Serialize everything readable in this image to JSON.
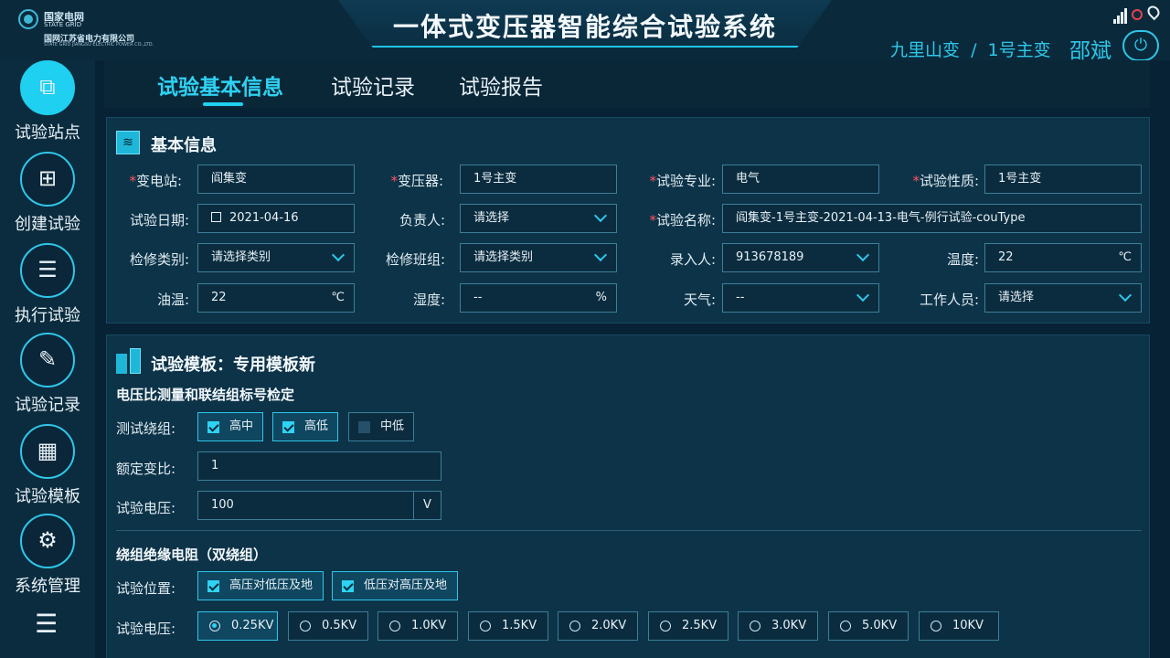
{
  "header": {
    "title": "一体式变压器智能综合试验系统",
    "logo": {
      "name": "国家电网",
      "en": "STATE GRID",
      "sub": "国网江苏省电力有限公司",
      "sub_en": "STATE GRID JIANGSU ELECTRIC POWER CO.,LTD."
    },
    "location": "九里山变  /  1号主变",
    "user": "邵斌",
    "icons": [
      "signal-icon",
      "warning-icon",
      "location-pin-icon",
      "power-icon"
    ]
  },
  "sidebar": {
    "items": [
      {
        "label": "试验站点",
        "icon": "sitemap-icon",
        "active": true
      },
      {
        "label": "创建试验",
        "icon": "document-add-icon",
        "active": false
      },
      {
        "label": "执行试验",
        "icon": "document-run-icon",
        "active": false
      },
      {
        "label": "试验记录",
        "icon": "document-edit-icon",
        "active": false
      },
      {
        "label": "试验模板",
        "icon": "template-grid-icon",
        "active": false
      },
      {
        "label": "系统管理",
        "icon": "settings-calendar-icon",
        "active": false
      }
    ],
    "menu_icon": "menu-collapse-icon"
  },
  "tabs": [
    {
      "label": "试验基本信息",
      "active": true
    },
    {
      "label": "试验记录",
      "active": false
    },
    {
      "label": "试验报告",
      "active": false
    }
  ],
  "basic": {
    "title": "基本信息",
    "fields": [
      {
        "label": "变电站:",
        "required": true,
        "value": "阎集变",
        "type": "text"
      },
      {
        "label": "变压器:",
        "required": true,
        "value": "1号主变",
        "type": "text"
      },
      {
        "label": "试验专业:",
        "required": true,
        "value": "电气",
        "type": "text"
      },
      {
        "label": "试验性质:",
        "required": true,
        "value": "1号主变",
        "type": "text"
      },
      {
        "label": "试验日期:",
        "required": false,
        "value": "2021-04-16",
        "type": "date"
      },
      {
        "label": "负责人:",
        "required": false,
        "value": "请选择",
        "type": "select"
      },
      {
        "label": "试验名称:",
        "required": true,
        "value": "阎集变-1号主变-2021-04-13-电气-例行试验-couType",
        "type": "text-wide"
      },
      {
        "label": "检修类别:",
        "required": false,
        "value": "请选择类别",
        "type": "select"
      },
      {
        "label": "检修班组:",
        "required": false,
        "value": "请选择类别",
        "type": "select"
      },
      {
        "label": "录入人:",
        "required": false,
        "value": "913678189",
        "type": "select"
      },
      {
        "label": "温度:",
        "required": false,
        "value": "22",
        "unit": "℃",
        "type": "unit"
      },
      {
        "label": "油温:",
        "required": false,
        "value": "22",
        "unit": "℃",
        "type": "unit"
      },
      {
        "label": "湿度:",
        "required": false,
        "value": "--",
        "unit": "%",
        "type": "unit"
      },
      {
        "label": "天气:",
        "required": false,
        "value": "--",
        "type": "select"
      },
      {
        "label": "工作人员:",
        "required": false,
        "value": "请选择",
        "type": "select"
      }
    ]
  },
  "template": {
    "title": "试验模板：专用模板新",
    "section1": {
      "title": "电压比测量和联结组标号检定",
      "winding_label": "测试绕组:",
      "windings": [
        {
          "label": "高中",
          "checked": true
        },
        {
          "label": "高低",
          "checked": true
        },
        {
          "label": "中低",
          "checked": false
        }
      ],
      "ratio_label": "额定变比:",
      "ratio_value": "1",
      "voltage_label": "试验电压:",
      "voltage_value": "100",
      "voltage_unit": "V"
    },
    "section2": {
      "title": "绕组绝缘电阻（双绕组）",
      "position_label": "试验位置:",
      "positions": [
        {
          "label": "高压对低压及地",
          "checked": true
        },
        {
          "label": "低压对高压及地",
          "checked": true
        }
      ],
      "voltage_label": "试验电压:",
      "voltages": [
        {
          "label": "0.25KV",
          "selected": true
        },
        {
          "label": "0.5KV",
          "selected": false
        },
        {
          "label": "1.0KV",
          "selected": false
        },
        {
          "label": "1.5KV",
          "selected": false
        },
        {
          "label": "2.0KV",
          "selected": false
        },
        {
          "label": "2.5KV",
          "selected": false
        },
        {
          "label": "3.0KV",
          "selected": false
        },
        {
          "label": "5.0KV",
          "selected": false
        },
        {
          "label": "10KV",
          "selected": false
        }
      ]
    }
  }
}
